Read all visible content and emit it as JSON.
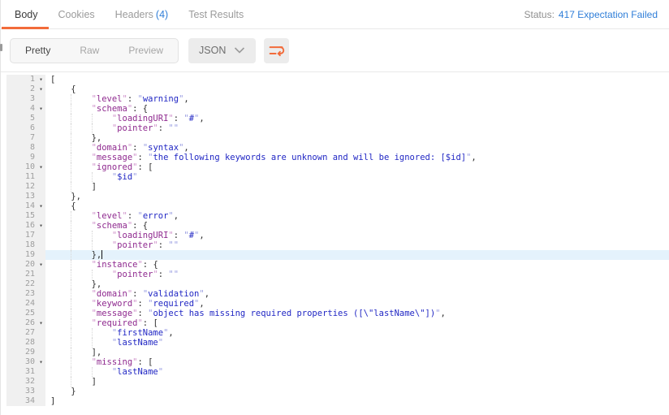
{
  "header": {
    "tabs": [
      {
        "label": "Body",
        "active": true
      },
      {
        "label": "Cookies",
        "active": false
      },
      {
        "label": "Headers",
        "count": "(4)",
        "active": false
      },
      {
        "label": "Test Results",
        "active": false
      }
    ],
    "status_label": "Status:",
    "status_value": "417 Expectation Failed"
  },
  "toolbar": {
    "views": [
      {
        "label": "Pretty",
        "active": true
      },
      {
        "label": "Raw",
        "active": false
      },
      {
        "label": "Preview",
        "active": false
      }
    ],
    "format_select": {
      "value": "JSON"
    }
  },
  "colors": {
    "accent_orange": "#f26b3a",
    "link_blue": "#2f7ed8",
    "json_key": "#8f2a8f",
    "json_string": "#2127c4",
    "active_line_bg": "#e4f2fc",
    "gutter_bg": "#f0f0f0"
  },
  "editor": {
    "language": "JSON",
    "active_line": 19,
    "cursor_line": 19,
    "lines": [
      {
        "n": 1,
        "fold": true,
        "indent": 0,
        "tokens": [
          {
            "t": "p",
            "v": "["
          }
        ]
      },
      {
        "n": 2,
        "fold": true,
        "indent": 1,
        "tokens": [
          {
            "t": "p",
            "v": "{"
          }
        ]
      },
      {
        "n": 3,
        "fold": false,
        "indent": 2,
        "tokens": [
          {
            "t": "k",
            "v": "level"
          },
          {
            "t": "p",
            "v": ": "
          },
          {
            "t": "s",
            "v": "warning"
          },
          {
            "t": "p",
            "v": ","
          }
        ]
      },
      {
        "n": 4,
        "fold": true,
        "indent": 2,
        "tokens": [
          {
            "t": "k",
            "v": "schema"
          },
          {
            "t": "p",
            "v": ": {"
          }
        ]
      },
      {
        "n": 5,
        "fold": false,
        "indent": 3,
        "tokens": [
          {
            "t": "k",
            "v": "loadingURI"
          },
          {
            "t": "p",
            "v": ": "
          },
          {
            "t": "s",
            "v": "#"
          },
          {
            "t": "p",
            "v": ","
          }
        ]
      },
      {
        "n": 6,
        "fold": false,
        "indent": 3,
        "tokens": [
          {
            "t": "k",
            "v": "pointer"
          },
          {
            "t": "p",
            "v": ": "
          },
          {
            "t": "s",
            "v": ""
          }
        ]
      },
      {
        "n": 7,
        "fold": false,
        "indent": 2,
        "tokens": [
          {
            "t": "p",
            "v": "},"
          }
        ]
      },
      {
        "n": 8,
        "fold": false,
        "indent": 2,
        "tokens": [
          {
            "t": "k",
            "v": "domain"
          },
          {
            "t": "p",
            "v": ": "
          },
          {
            "t": "s",
            "v": "syntax"
          },
          {
            "t": "p",
            "v": ","
          }
        ]
      },
      {
        "n": 9,
        "fold": false,
        "indent": 2,
        "tokens": [
          {
            "t": "k",
            "v": "message"
          },
          {
            "t": "p",
            "v": ": "
          },
          {
            "t": "s",
            "v": "the following keywords are unknown and will be ignored: [$id]"
          },
          {
            "t": "p",
            "v": ","
          }
        ]
      },
      {
        "n": 10,
        "fold": true,
        "indent": 2,
        "tokens": [
          {
            "t": "k",
            "v": "ignored"
          },
          {
            "t": "p",
            "v": ": ["
          }
        ]
      },
      {
        "n": 11,
        "fold": false,
        "indent": 3,
        "tokens": [
          {
            "t": "s",
            "v": "$id"
          }
        ]
      },
      {
        "n": 12,
        "fold": false,
        "indent": 2,
        "tokens": [
          {
            "t": "p",
            "v": "]"
          }
        ]
      },
      {
        "n": 13,
        "fold": false,
        "indent": 1,
        "tokens": [
          {
            "t": "p",
            "v": "},"
          }
        ]
      },
      {
        "n": 14,
        "fold": true,
        "indent": 1,
        "tokens": [
          {
            "t": "p",
            "v": "{"
          }
        ]
      },
      {
        "n": 15,
        "fold": false,
        "indent": 2,
        "tokens": [
          {
            "t": "k",
            "v": "level"
          },
          {
            "t": "p",
            "v": ": "
          },
          {
            "t": "s",
            "v": "error"
          },
          {
            "t": "p",
            "v": ","
          }
        ]
      },
      {
        "n": 16,
        "fold": true,
        "indent": 2,
        "tokens": [
          {
            "t": "k",
            "v": "schema"
          },
          {
            "t": "p",
            "v": ": {"
          }
        ]
      },
      {
        "n": 17,
        "fold": false,
        "indent": 3,
        "tokens": [
          {
            "t": "k",
            "v": "loadingURI"
          },
          {
            "t": "p",
            "v": ": "
          },
          {
            "t": "s",
            "v": "#"
          },
          {
            "t": "p",
            "v": ","
          }
        ]
      },
      {
        "n": 18,
        "fold": false,
        "indent": 3,
        "tokens": [
          {
            "t": "k",
            "v": "pointer"
          },
          {
            "t": "p",
            "v": ": "
          },
          {
            "t": "s",
            "v": ""
          }
        ]
      },
      {
        "n": 19,
        "fold": false,
        "indent": 2,
        "tokens": [
          {
            "t": "p",
            "v": "},"
          }
        ]
      },
      {
        "n": 20,
        "fold": true,
        "indent": 2,
        "tokens": [
          {
            "t": "k",
            "v": "instance"
          },
          {
            "t": "p",
            "v": ": {"
          }
        ]
      },
      {
        "n": 21,
        "fold": false,
        "indent": 3,
        "tokens": [
          {
            "t": "k",
            "v": "pointer"
          },
          {
            "t": "p",
            "v": ": "
          },
          {
            "t": "s",
            "v": ""
          }
        ]
      },
      {
        "n": 22,
        "fold": false,
        "indent": 2,
        "tokens": [
          {
            "t": "p",
            "v": "},"
          }
        ]
      },
      {
        "n": 23,
        "fold": false,
        "indent": 2,
        "tokens": [
          {
            "t": "k",
            "v": "domain"
          },
          {
            "t": "p",
            "v": ": "
          },
          {
            "t": "s",
            "v": "validation"
          },
          {
            "t": "p",
            "v": ","
          }
        ]
      },
      {
        "n": 24,
        "fold": false,
        "indent": 2,
        "tokens": [
          {
            "t": "k",
            "v": "keyword"
          },
          {
            "t": "p",
            "v": ": "
          },
          {
            "t": "s",
            "v": "required"
          },
          {
            "t": "p",
            "v": ","
          }
        ]
      },
      {
        "n": 25,
        "fold": false,
        "indent": 2,
        "tokens": [
          {
            "t": "k",
            "v": "message"
          },
          {
            "t": "p",
            "v": ": "
          },
          {
            "t": "s",
            "v": "object has missing required properties ([\\\"lastName\\\"])"
          },
          {
            "t": "p",
            "v": ","
          }
        ]
      },
      {
        "n": 26,
        "fold": true,
        "indent": 2,
        "tokens": [
          {
            "t": "k",
            "v": "required"
          },
          {
            "t": "p",
            "v": ": ["
          }
        ]
      },
      {
        "n": 27,
        "fold": false,
        "indent": 3,
        "tokens": [
          {
            "t": "s",
            "v": "firstName"
          },
          {
            "t": "p",
            "v": ","
          }
        ]
      },
      {
        "n": 28,
        "fold": false,
        "indent": 3,
        "tokens": [
          {
            "t": "s",
            "v": "lastName"
          }
        ]
      },
      {
        "n": 29,
        "fold": false,
        "indent": 2,
        "tokens": [
          {
            "t": "p",
            "v": "],"
          }
        ]
      },
      {
        "n": 30,
        "fold": true,
        "indent": 2,
        "tokens": [
          {
            "t": "k",
            "v": "missing"
          },
          {
            "t": "p",
            "v": ": ["
          }
        ]
      },
      {
        "n": 31,
        "fold": false,
        "indent": 3,
        "tokens": [
          {
            "t": "s",
            "v": "lastName"
          }
        ]
      },
      {
        "n": 32,
        "fold": false,
        "indent": 2,
        "tokens": [
          {
            "t": "p",
            "v": "]"
          }
        ]
      },
      {
        "n": 33,
        "fold": false,
        "indent": 1,
        "tokens": [
          {
            "t": "p",
            "v": "}"
          }
        ]
      },
      {
        "n": 34,
        "fold": false,
        "indent": 0,
        "tokens": [
          {
            "t": "p",
            "v": "]"
          }
        ]
      }
    ]
  }
}
